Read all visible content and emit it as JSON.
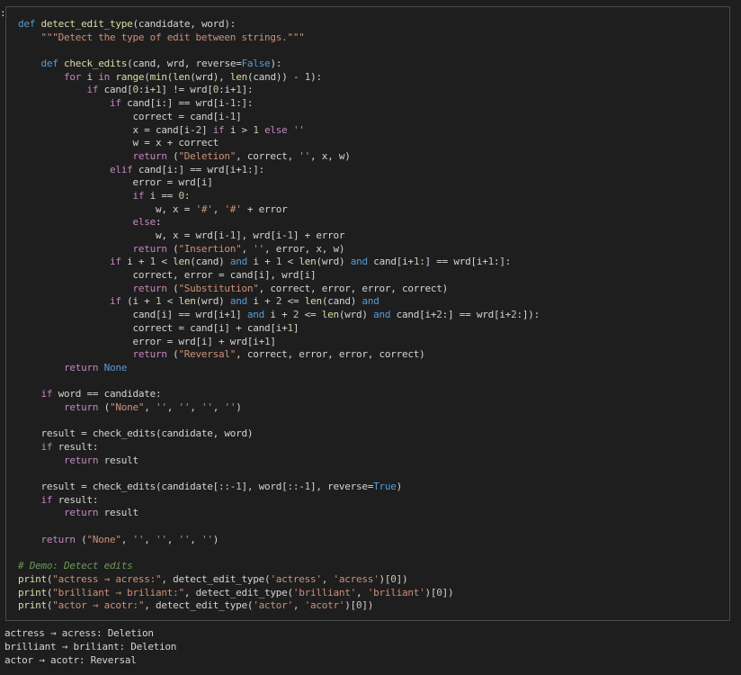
{
  "prompt_marker": ":",
  "code_lines": [
    [
      {
        "t": "def ",
        "c": "kw"
      },
      {
        "t": "detect_edit_type",
        "c": "fn"
      },
      {
        "t": "(candidate, word):",
        "c": "pl"
      }
    ],
    [
      {
        "t": "    ",
        "c": "pl"
      },
      {
        "t": "\"\"\"Detect the type of edit between strings.\"\"\"",
        "c": "str"
      }
    ],
    [
      {
        "t": "",
        "c": "pl"
      }
    ],
    [
      {
        "t": "    ",
        "c": "pl"
      },
      {
        "t": "def ",
        "c": "kw"
      },
      {
        "t": "check_edits",
        "c": "fn"
      },
      {
        "t": "(cand, wrd, reverse=",
        "c": "pl"
      },
      {
        "t": "False",
        "c": "kw"
      },
      {
        "t": "):",
        "c": "pl"
      }
    ],
    [
      {
        "t": "        ",
        "c": "pl"
      },
      {
        "t": "for ",
        "c": "ctl"
      },
      {
        "t": "i ",
        "c": "pl"
      },
      {
        "t": "in ",
        "c": "ctl"
      },
      {
        "t": "range",
        "c": "fn"
      },
      {
        "t": "(",
        "c": "pl"
      },
      {
        "t": "min",
        "c": "fn"
      },
      {
        "t": "(",
        "c": "pl"
      },
      {
        "t": "len",
        "c": "fn"
      },
      {
        "t": "(wrd), ",
        "c": "pl"
      },
      {
        "t": "len",
        "c": "fn"
      },
      {
        "t": "(cand)) - ",
        "c": "pl"
      },
      {
        "t": "1",
        "c": "num"
      },
      {
        "t": "):",
        "c": "pl"
      }
    ],
    [
      {
        "t": "            ",
        "c": "pl"
      },
      {
        "t": "if ",
        "c": "ctl"
      },
      {
        "t": "cand[",
        "c": "pl"
      },
      {
        "t": "0",
        "c": "num"
      },
      {
        "t": ":i+",
        "c": "pl"
      },
      {
        "t": "1",
        "c": "num"
      },
      {
        "t": "] != wrd[",
        "c": "pl"
      },
      {
        "t": "0",
        "c": "num"
      },
      {
        "t": ":i+",
        "c": "pl"
      },
      {
        "t": "1",
        "c": "num"
      },
      {
        "t": "]:",
        "c": "pl"
      }
    ],
    [
      {
        "t": "                ",
        "c": "pl"
      },
      {
        "t": "if ",
        "c": "ctl"
      },
      {
        "t": "cand[i:] == wrd[i-",
        "c": "pl"
      },
      {
        "t": "1",
        "c": "num"
      },
      {
        "t": ":]:",
        "c": "pl"
      }
    ],
    [
      {
        "t": "                    correct = cand[i-",
        "c": "pl"
      },
      {
        "t": "1",
        "c": "num"
      },
      {
        "t": "]",
        "c": "pl"
      }
    ],
    [
      {
        "t": "                    x = cand[i-",
        "c": "pl"
      },
      {
        "t": "2",
        "c": "num"
      },
      {
        "t": "] ",
        "c": "pl"
      },
      {
        "t": "if ",
        "c": "ctl"
      },
      {
        "t": "i > ",
        "c": "pl"
      },
      {
        "t": "1 ",
        "c": "num"
      },
      {
        "t": "else ",
        "c": "ctl"
      },
      {
        "t": "''",
        "c": "str"
      }
    ],
    [
      {
        "t": "                    w = x + correct",
        "c": "pl"
      }
    ],
    [
      {
        "t": "                    ",
        "c": "pl"
      },
      {
        "t": "return ",
        "c": "ctl"
      },
      {
        "t": "(",
        "c": "pl"
      },
      {
        "t": "\"Deletion\"",
        "c": "str"
      },
      {
        "t": ", correct, ",
        "c": "pl"
      },
      {
        "t": "''",
        "c": "str"
      },
      {
        "t": ", x, w)",
        "c": "pl"
      }
    ],
    [
      {
        "t": "                ",
        "c": "pl"
      },
      {
        "t": "elif ",
        "c": "ctl"
      },
      {
        "t": "cand[i:] == wrd[i+",
        "c": "pl"
      },
      {
        "t": "1",
        "c": "num"
      },
      {
        "t": ":]:",
        "c": "pl"
      }
    ],
    [
      {
        "t": "                    error = wrd[i]",
        "c": "pl"
      }
    ],
    [
      {
        "t": "                    ",
        "c": "pl"
      },
      {
        "t": "if ",
        "c": "ctl"
      },
      {
        "t": "i == ",
        "c": "pl"
      },
      {
        "t": "0",
        "c": "num"
      },
      {
        "t": ":",
        "c": "pl"
      }
    ],
    [
      {
        "t": "                        w, x = ",
        "c": "pl"
      },
      {
        "t": "'#'",
        "c": "str"
      },
      {
        "t": ", ",
        "c": "pl"
      },
      {
        "t": "'#'",
        "c": "str"
      },
      {
        "t": " + error",
        "c": "pl"
      }
    ],
    [
      {
        "t": "                    ",
        "c": "pl"
      },
      {
        "t": "else",
        "c": "ctl"
      },
      {
        "t": ":",
        "c": "pl"
      }
    ],
    [
      {
        "t": "                        w, x = wrd[i-",
        "c": "pl"
      },
      {
        "t": "1",
        "c": "num"
      },
      {
        "t": "], wrd[i-",
        "c": "pl"
      },
      {
        "t": "1",
        "c": "num"
      },
      {
        "t": "] + error",
        "c": "pl"
      }
    ],
    [
      {
        "t": "                    ",
        "c": "pl"
      },
      {
        "t": "return ",
        "c": "ctl"
      },
      {
        "t": "(",
        "c": "pl"
      },
      {
        "t": "\"Insertion\"",
        "c": "str"
      },
      {
        "t": ", ",
        "c": "pl"
      },
      {
        "t": "''",
        "c": "str"
      },
      {
        "t": ", error, x, w)",
        "c": "pl"
      }
    ],
    [
      {
        "t": "                ",
        "c": "pl"
      },
      {
        "t": "if ",
        "c": "ctl"
      },
      {
        "t": "i + ",
        "c": "pl"
      },
      {
        "t": "1",
        "c": "num"
      },
      {
        "t": " < ",
        "c": "pl"
      },
      {
        "t": "len",
        "c": "fn"
      },
      {
        "t": "(cand) ",
        "c": "pl"
      },
      {
        "t": "and ",
        "c": "kw"
      },
      {
        "t": "i + ",
        "c": "pl"
      },
      {
        "t": "1",
        "c": "num"
      },
      {
        "t": " < ",
        "c": "pl"
      },
      {
        "t": "len",
        "c": "fn"
      },
      {
        "t": "(wrd) ",
        "c": "pl"
      },
      {
        "t": "and ",
        "c": "kw"
      },
      {
        "t": "cand[i+",
        "c": "pl"
      },
      {
        "t": "1",
        "c": "num"
      },
      {
        "t": ":] == wrd[i+",
        "c": "pl"
      },
      {
        "t": "1",
        "c": "num"
      },
      {
        "t": ":]:",
        "c": "pl"
      }
    ],
    [
      {
        "t": "                    correct, error = cand[i], wrd[i]",
        "c": "pl"
      }
    ],
    [
      {
        "t": "                    ",
        "c": "pl"
      },
      {
        "t": "return ",
        "c": "ctl"
      },
      {
        "t": "(",
        "c": "pl"
      },
      {
        "t": "\"Substitution\"",
        "c": "str"
      },
      {
        "t": ", correct, error, error, correct)",
        "c": "pl"
      }
    ],
    [
      {
        "t": "                ",
        "c": "pl"
      },
      {
        "t": "if ",
        "c": "ctl"
      },
      {
        "t": "(i + ",
        "c": "pl"
      },
      {
        "t": "1",
        "c": "num"
      },
      {
        "t": " < ",
        "c": "pl"
      },
      {
        "t": "len",
        "c": "fn"
      },
      {
        "t": "(wrd) ",
        "c": "pl"
      },
      {
        "t": "and ",
        "c": "kw"
      },
      {
        "t": "i + ",
        "c": "pl"
      },
      {
        "t": "2",
        "c": "num"
      },
      {
        "t": " <= ",
        "c": "pl"
      },
      {
        "t": "len",
        "c": "fn"
      },
      {
        "t": "(cand) ",
        "c": "pl"
      },
      {
        "t": "and",
        "c": "kw"
      }
    ],
    [
      {
        "t": "                    cand[i] == wrd[i+",
        "c": "pl"
      },
      {
        "t": "1",
        "c": "num"
      },
      {
        "t": "] ",
        "c": "pl"
      },
      {
        "t": "and ",
        "c": "kw"
      },
      {
        "t": "i + ",
        "c": "pl"
      },
      {
        "t": "2",
        "c": "num"
      },
      {
        "t": " <= ",
        "c": "pl"
      },
      {
        "t": "len",
        "c": "fn"
      },
      {
        "t": "(wrd) ",
        "c": "pl"
      },
      {
        "t": "and ",
        "c": "kw"
      },
      {
        "t": "cand[i+",
        "c": "pl"
      },
      {
        "t": "2",
        "c": "num"
      },
      {
        "t": ":] == wrd[i+",
        "c": "pl"
      },
      {
        "t": "2",
        "c": "num"
      },
      {
        "t": ":]):",
        "c": "pl"
      }
    ],
    [
      {
        "t": "                    correct = cand[i] + cand[i+",
        "c": "pl"
      },
      {
        "t": "1",
        "c": "num"
      },
      {
        "t": "]",
        "c": "pl"
      }
    ],
    [
      {
        "t": "                    error = wrd[i] + wrd[i+",
        "c": "pl"
      },
      {
        "t": "1",
        "c": "num"
      },
      {
        "t": "]",
        "c": "pl"
      }
    ],
    [
      {
        "t": "                    ",
        "c": "pl"
      },
      {
        "t": "return ",
        "c": "ctl"
      },
      {
        "t": "(",
        "c": "pl"
      },
      {
        "t": "\"Reversal\"",
        "c": "str"
      },
      {
        "t": ", correct, error, error, correct)",
        "c": "pl"
      }
    ],
    [
      {
        "t": "        ",
        "c": "pl"
      },
      {
        "t": "return ",
        "c": "ctl"
      },
      {
        "t": "None",
        "c": "kw"
      }
    ],
    [
      {
        "t": "",
        "c": "pl"
      }
    ],
    [
      {
        "t": "    ",
        "c": "pl"
      },
      {
        "t": "if ",
        "c": "ctl"
      },
      {
        "t": "word == candidate:",
        "c": "pl"
      }
    ],
    [
      {
        "t": "        ",
        "c": "pl"
      },
      {
        "t": "return ",
        "c": "ctl"
      },
      {
        "t": "(",
        "c": "pl"
      },
      {
        "t": "\"None\"",
        "c": "str"
      },
      {
        "t": ", ",
        "c": "pl"
      },
      {
        "t": "''",
        "c": "str"
      },
      {
        "t": ", ",
        "c": "pl"
      },
      {
        "t": "''",
        "c": "str"
      },
      {
        "t": ", ",
        "c": "pl"
      },
      {
        "t": "''",
        "c": "str"
      },
      {
        "t": ", ",
        "c": "pl"
      },
      {
        "t": "''",
        "c": "str"
      },
      {
        "t": ")",
        "c": "pl"
      }
    ],
    [
      {
        "t": "",
        "c": "pl"
      }
    ],
    [
      {
        "t": "    result = check_edits(candidate, word)",
        "c": "pl"
      }
    ],
    [
      {
        "t": "    ",
        "c": "pl"
      },
      {
        "t": "if ",
        "c": "ctl"
      },
      {
        "t": "result:",
        "c": "pl"
      }
    ],
    [
      {
        "t": "        ",
        "c": "pl"
      },
      {
        "t": "return ",
        "c": "ctl"
      },
      {
        "t": "result",
        "c": "pl"
      }
    ],
    [
      {
        "t": "",
        "c": "pl"
      }
    ],
    [
      {
        "t": "    result = check_edits(candidate[::-",
        "c": "pl"
      },
      {
        "t": "1",
        "c": "num"
      },
      {
        "t": "], word[::-",
        "c": "pl"
      },
      {
        "t": "1",
        "c": "num"
      },
      {
        "t": "], reverse=",
        "c": "pl"
      },
      {
        "t": "True",
        "c": "kw"
      },
      {
        "t": ")",
        "c": "pl"
      }
    ],
    [
      {
        "t": "    ",
        "c": "pl"
      },
      {
        "t": "if ",
        "c": "ctl"
      },
      {
        "t": "result:",
        "c": "pl"
      }
    ],
    [
      {
        "t": "        ",
        "c": "pl"
      },
      {
        "t": "return ",
        "c": "ctl"
      },
      {
        "t": "result",
        "c": "pl"
      }
    ],
    [
      {
        "t": "",
        "c": "pl"
      }
    ],
    [
      {
        "t": "    ",
        "c": "pl"
      },
      {
        "t": "return ",
        "c": "ctl"
      },
      {
        "t": "(",
        "c": "pl"
      },
      {
        "t": "\"None\"",
        "c": "str"
      },
      {
        "t": ", ",
        "c": "pl"
      },
      {
        "t": "''",
        "c": "str"
      },
      {
        "t": ", ",
        "c": "pl"
      },
      {
        "t": "''",
        "c": "str"
      },
      {
        "t": ", ",
        "c": "pl"
      },
      {
        "t": "''",
        "c": "str"
      },
      {
        "t": ", ",
        "c": "pl"
      },
      {
        "t": "''",
        "c": "str"
      },
      {
        "t": ")",
        "c": "pl"
      }
    ],
    [
      {
        "t": "",
        "c": "pl"
      }
    ],
    [
      {
        "t": "# Demo: Detect edits",
        "c": "cm"
      }
    ],
    [
      {
        "t": "print",
        "c": "fn"
      },
      {
        "t": "(",
        "c": "pl"
      },
      {
        "t": "\"actress → acress:\"",
        "c": "str"
      },
      {
        "t": ", detect_edit_type(",
        "c": "pl"
      },
      {
        "t": "'actress'",
        "c": "str"
      },
      {
        "t": ", ",
        "c": "pl"
      },
      {
        "t": "'acress'",
        "c": "str"
      },
      {
        "t": ")[",
        "c": "pl"
      },
      {
        "t": "0",
        "c": "num"
      },
      {
        "t": "])",
        "c": "pl"
      }
    ],
    [
      {
        "t": "print",
        "c": "fn"
      },
      {
        "t": "(",
        "c": "pl"
      },
      {
        "t": "\"brilliant → briliant:\"",
        "c": "str"
      },
      {
        "t": ", detect_edit_type(",
        "c": "pl"
      },
      {
        "t": "'brilliant'",
        "c": "str"
      },
      {
        "t": ", ",
        "c": "pl"
      },
      {
        "t": "'briliant'",
        "c": "str"
      },
      {
        "t": ")[",
        "c": "pl"
      },
      {
        "t": "0",
        "c": "num"
      },
      {
        "t": "])",
        "c": "pl"
      }
    ],
    [
      {
        "t": "print",
        "c": "fn"
      },
      {
        "t": "(",
        "c": "pl"
      },
      {
        "t": "\"actor → acotr:\"",
        "c": "str"
      },
      {
        "t": ", detect_edit_type(",
        "c": "pl"
      },
      {
        "t": "'actor'",
        "c": "str"
      },
      {
        "t": ", ",
        "c": "pl"
      },
      {
        "t": "'acotr'",
        "c": "str"
      },
      {
        "t": ")[",
        "c": "pl"
      },
      {
        "t": "0",
        "c": "num"
      },
      {
        "t": "])",
        "c": "pl"
      }
    ]
  ],
  "output_lines": [
    "actress → acress: Deletion",
    "brilliant → briliant: Deletion",
    "actor → acotr: Reversal"
  ],
  "colors": {
    "background": "#1e1e1e",
    "cell_border": "#4a4a4a",
    "keyword": "#569cd6",
    "control": "#c586c0",
    "function": "#dcdcaa",
    "string": "#ce9178",
    "number": "#b5cea8",
    "comment": "#6a9955",
    "text": "#d4d4d4"
  }
}
